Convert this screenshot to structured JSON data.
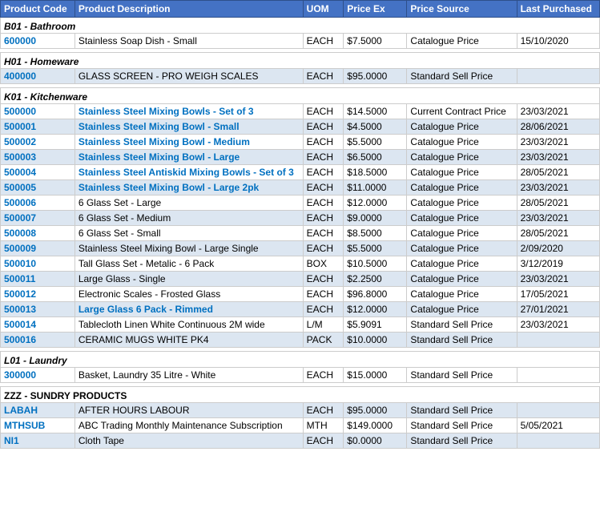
{
  "table": {
    "headers": {
      "product_code": "Product Code",
      "product_description": "Product Description",
      "uom": "UOM",
      "price_ex": "Price Ex",
      "price_source": "Price Source",
      "last_purchased": "Last Purchased"
    },
    "groups": [
      {
        "id": "B01",
        "label": "B01 - Bathroom",
        "rows": [
          {
            "code": "600000",
            "desc": "Stainless Soap Dish - Small",
            "desc_linked": false,
            "uom": "EACH",
            "price": "$7.5000",
            "source": "Catalogue Price",
            "last": "15/10/2020"
          }
        ]
      },
      {
        "id": "H01",
        "label": "H01 - Homeware",
        "rows": [
          {
            "code": "400000",
            "desc": "GLASS SCREEN - PRO WEIGH SCALES",
            "desc_linked": false,
            "uom": "EACH",
            "price": "$95.0000",
            "source": "Standard Sell Price",
            "last": ""
          }
        ]
      },
      {
        "id": "K01",
        "label": "K01 - Kitchenware",
        "rows": [
          {
            "code": "500000",
            "desc": "Stainless Steel Mixing Bowls - Set of 3",
            "desc_linked": true,
            "uom": "EACH",
            "price": "$14.5000",
            "source": "Current Contract Price",
            "last": "23/03/2021"
          },
          {
            "code": "500001",
            "desc": "Stainless Steel Mixing Bowl - Small",
            "desc_linked": true,
            "uom": "EACH",
            "price": "$4.5000",
            "source": "Catalogue Price",
            "last": "28/06/2021"
          },
          {
            "code": "500002",
            "desc": "Stainless Steel Mixing Bowl - Medium",
            "desc_linked": true,
            "uom": "EACH",
            "price": "$5.5000",
            "source": "Catalogue Price",
            "last": "23/03/2021"
          },
          {
            "code": "500003",
            "desc": "Stainless Steel Mixing Bowl - Large",
            "desc_linked": true,
            "uom": "EACH",
            "price": "$6.5000",
            "source": "Catalogue Price",
            "last": "23/03/2021"
          },
          {
            "code": "500004",
            "desc": "Stainless Steel Antiskid Mixing Bowls - Set of 3",
            "desc_linked": true,
            "uom": "EACH",
            "price": "$18.5000",
            "source": "Catalogue Price",
            "last": "28/05/2021"
          },
          {
            "code": "500005",
            "desc": "Stainless Steel Mixing Bowl - Large 2pk",
            "desc_linked": true,
            "uom": "EACH",
            "price": "$11.0000",
            "source": "Catalogue Price",
            "last": "23/03/2021"
          },
          {
            "code": "500006",
            "desc": "6 Glass Set - Large",
            "desc_linked": false,
            "uom": "EACH",
            "price": "$12.0000",
            "source": "Catalogue Price",
            "last": "28/05/2021"
          },
          {
            "code": "500007",
            "desc": "6 Glass Set - Medium",
            "desc_linked": false,
            "uom": "EACH",
            "price": "$9.0000",
            "source": "Catalogue Price",
            "last": "23/03/2021"
          },
          {
            "code": "500008",
            "desc": "6 Glass Set - Small",
            "desc_linked": false,
            "uom": "EACH",
            "price": "$8.5000",
            "source": "Catalogue Price",
            "last": "28/05/2021"
          },
          {
            "code": "500009",
            "desc": "Stainless Steel Mixing Bowl - Large Single",
            "desc_linked": false,
            "uom": "EACH",
            "price": "$5.5000",
            "source": "Catalogue Price",
            "last": "2/09/2020"
          },
          {
            "code": "500010",
            "desc": "Tall Glass Set - Metalic - 6 Pack",
            "desc_linked": false,
            "uom": "BOX",
            "price": "$10.5000",
            "source": "Catalogue Price",
            "last": "3/12/2019"
          },
          {
            "code": "500011",
            "desc": "Large Glass - Single",
            "desc_linked": false,
            "uom": "EACH",
            "price": "$2.2500",
            "source": "Catalogue Price",
            "last": "23/03/2021"
          },
          {
            "code": "500012",
            "desc": "Electronic Scales - Frosted Glass",
            "desc_linked": false,
            "uom": "EACH",
            "price": "$96.8000",
            "source": "Catalogue Price",
            "last": "17/05/2021"
          },
          {
            "code": "500013",
            "desc": "Large Glass 6 Pack - Rimmed",
            "desc_linked": true,
            "uom": "EACH",
            "price": "$12.0000",
            "source": "Catalogue Price",
            "last": "27/01/2021"
          },
          {
            "code": "500014",
            "desc": "Tablecloth Linen White Continuous 2M wide",
            "desc_linked": false,
            "uom": "L/M",
            "price": "$5.9091",
            "source": "Standard Sell Price",
            "last": "23/03/2021"
          },
          {
            "code": "500016",
            "desc": "CERAMIC MUGS WHITE PK4",
            "desc_linked": false,
            "uom": "PACK",
            "price": "$10.0000",
            "source": "Standard Sell Price",
            "last": ""
          }
        ]
      },
      {
        "id": "L01",
        "label": "L01 - Laundry",
        "rows": [
          {
            "code": "300000",
            "desc": "Basket, Laundry 35 Litre - White",
            "desc_linked": false,
            "uom": "EACH",
            "price": "$15.0000",
            "source": "Standard Sell Price",
            "last": ""
          }
        ]
      },
      {
        "id": "ZZZ",
        "label": "ZZZ - SUNDRY PRODUCTS",
        "label_bold": true,
        "rows": [
          {
            "code": "LABAH",
            "desc": "AFTER HOURS LABOUR",
            "desc_linked": false,
            "uom": "EACH",
            "price": "$95.0000",
            "source": "Standard Sell Price",
            "last": ""
          },
          {
            "code": "MTHSUB",
            "desc": "ABC Trading Monthly Maintenance Subscription",
            "desc_linked": false,
            "uom": "MTH",
            "price": "$149.0000",
            "source": "Standard Sell Price",
            "last": "5/05/2021"
          },
          {
            "code": "NI1",
            "desc": "Cloth Tape",
            "desc_linked": false,
            "uom": "EACH",
            "price": "$0.0000",
            "source": "Standard Sell Price",
            "last": ""
          }
        ]
      }
    ]
  }
}
